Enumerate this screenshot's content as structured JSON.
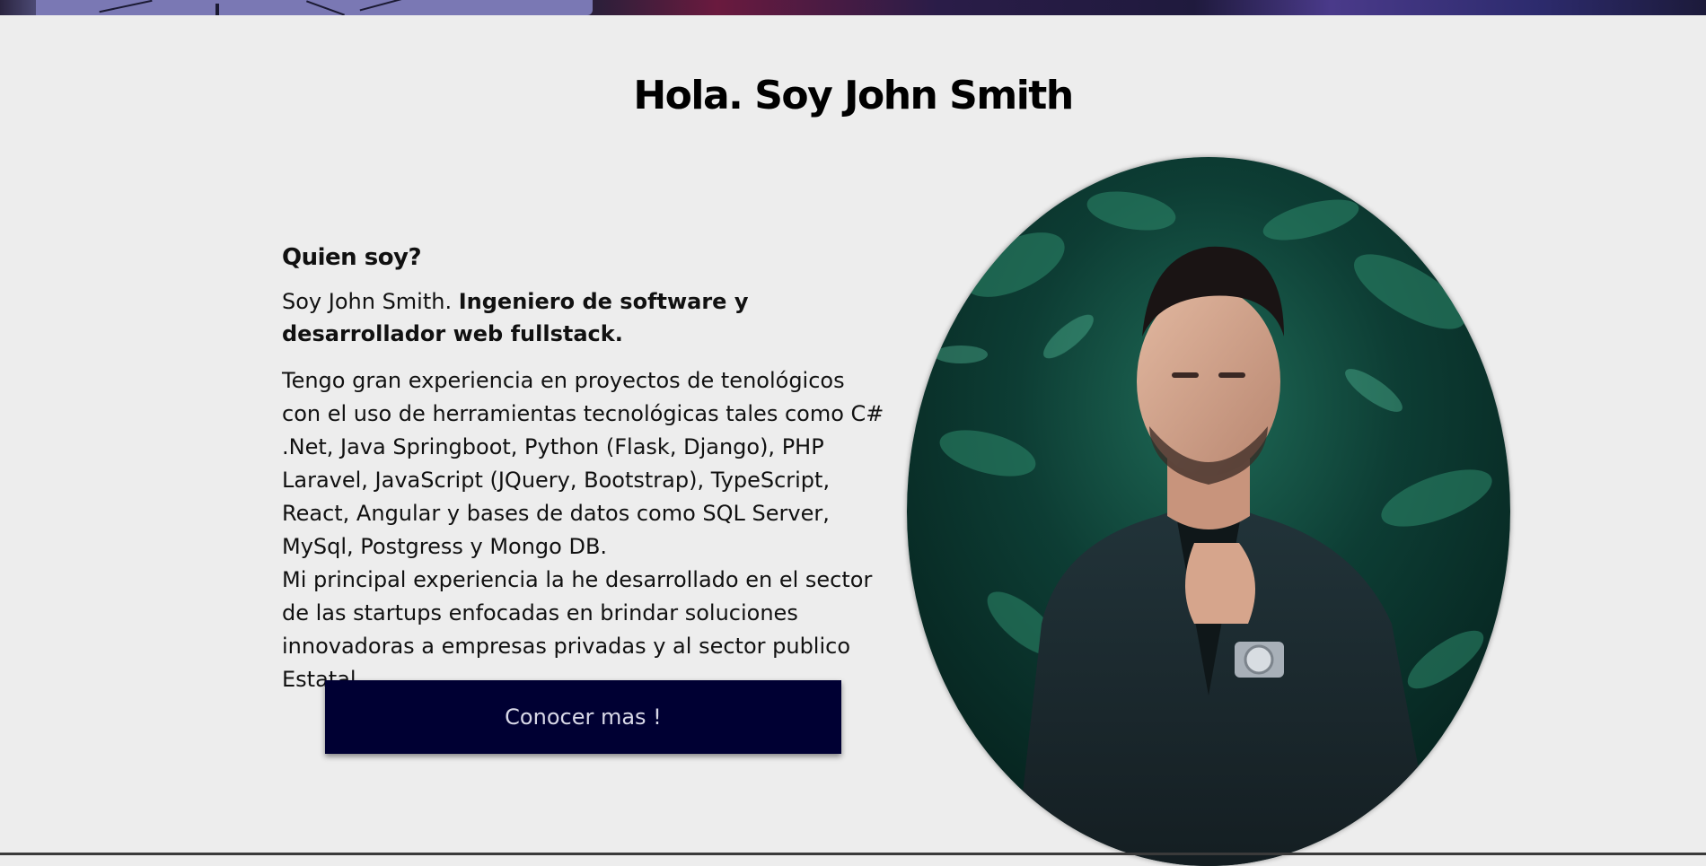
{
  "page": {
    "title": "Hola. Soy John Smith"
  },
  "about": {
    "heading": "Quien soy?",
    "intro_plain": "Soy John Smith. ",
    "intro_bold": "Ingeniero de software y desarrollador web fullstack.",
    "paragraph_1": "Tengo gran experiencia en proyectos de tenológicos con el uso de herramientas tecnológicas tales como C# .Net, Java Springboot, Python (Flask, Django), PHP Laravel, JavaScript (JQuery, Bootstrap), TypeScript, React, Angular y bases de datos como SQL Server, MySql, Postgress y Mongo DB.",
    "paragraph_2": "Mi principal experiencia la he desarrollado en el sector de las startups enfocadas en brindar soluciones innovadoras a empresas privadas y al sector publico Estatal."
  },
  "cta": {
    "label": "Conocer mas !"
  },
  "colors": {
    "background": "#ededed",
    "button_bg": "#000033",
    "button_text": "#d9d9e8",
    "foliage": "#0f4a3a",
    "jacket": "#1b2a2e"
  },
  "icons": {
    "profile_photo": "person-portrait-photo"
  }
}
